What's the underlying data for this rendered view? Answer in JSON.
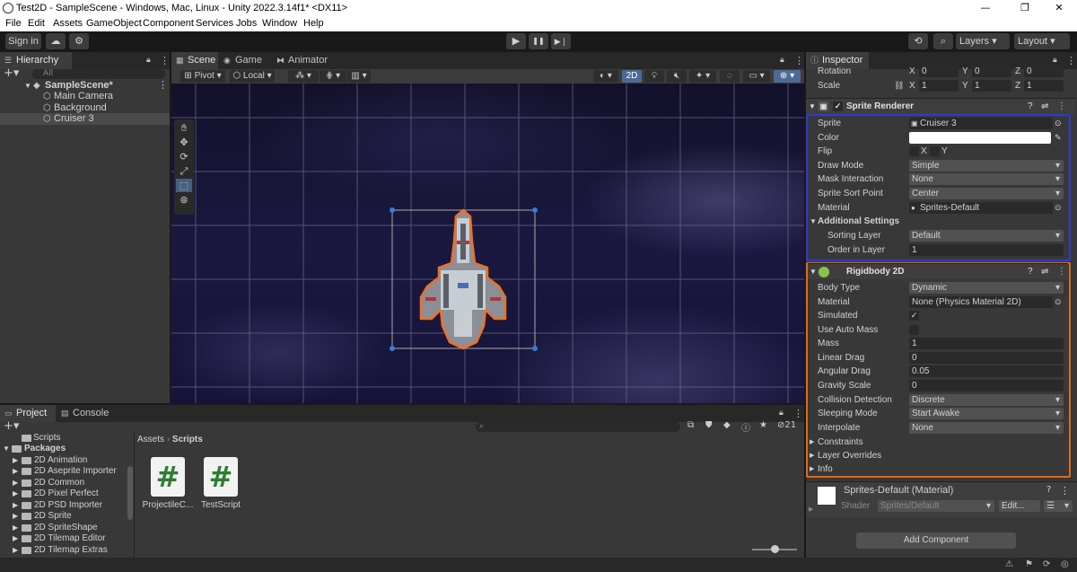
{
  "window": {
    "title": "Test2D - SampleScene - Windows, Mac, Linux - Unity 2022.3.14f1* <DX11>",
    "minimize": "—",
    "maximize": "❐",
    "close": "✕"
  },
  "menu": [
    "File",
    "Edit",
    "Assets",
    "GameObject",
    "Component",
    "Services",
    "Jobs",
    "Window",
    "Help"
  ],
  "toolbar": {
    "sign_in": "Sign in",
    "layers": "Layers",
    "layout": "Layout",
    "play": "▶",
    "pause": "❚❚",
    "step": "▶❘"
  },
  "hierarchy": {
    "tab": "Hierarchy",
    "search_placeholder": "All",
    "scene": "SampleScene*",
    "items": [
      "Main Camera",
      "Background",
      "Cruiser 3"
    ],
    "selected": "Cruiser 3"
  },
  "scene_panel": {
    "tabs": [
      "Scene",
      "Game",
      "Animator"
    ],
    "pivot": "Pivot",
    "local": "Local",
    "mode_2d": "2D"
  },
  "project": {
    "tabs": [
      "Project",
      "Console"
    ],
    "tree": [
      "Scripts",
      "Packages",
      "2D Animation",
      "2D Aseprite Importer",
      "2D Common",
      "2D Pixel Perfect",
      "2D PSD Importer",
      "2D Sprite",
      "2D SpriteShape",
      "2D Tilemap Editor",
      "2D Tilemap Extras"
    ],
    "breadcrumb": [
      "Assets",
      "Scripts"
    ],
    "assets": [
      {
        "name": "ProjectileC...",
        "icon": "#"
      },
      {
        "name": "TestScript",
        "icon": "#"
      }
    ],
    "hidden_count": "21"
  },
  "inspector": {
    "tab": "Inspector",
    "transform": {
      "rotation_label": "Rotation",
      "scale_label": "Scale",
      "rotation": {
        "x": "0",
        "y": "0",
        "z": "0"
      },
      "scale": {
        "x": "1",
        "y": "1",
        "z": "1"
      }
    },
    "sprite_renderer": {
      "title": "Sprite Renderer",
      "sprite_label": "Sprite",
      "sprite": "Cruiser 3",
      "color_label": "Color",
      "flip_label": "Flip",
      "flip_x": "X",
      "flip_y": "Y",
      "draw_mode_label": "Draw Mode",
      "draw_mode": "Simple",
      "mask_label": "Mask Interaction",
      "mask": "None",
      "sort_point_label": "Sprite Sort Point",
      "sort_point": "Center",
      "material_label": "Material",
      "material": "Sprites-Default",
      "additional_label": "Additional Settings",
      "sorting_layer_label": "Sorting Layer",
      "sorting_layer": "Default",
      "order_label": "Order in Layer",
      "order": "1"
    },
    "rigidbody": {
      "title": "Rigidbody 2D",
      "body_type_label": "Body Type",
      "body_type": "Dynamic",
      "material_label": "Material",
      "material": "None (Physics Material 2D)",
      "simulated_label": "Simulated",
      "simulated": "✓",
      "auto_mass_label": "Use Auto Mass",
      "mass_label": "Mass",
      "mass": "1",
      "linear_drag_label": "Linear Drag",
      "linear_drag": "0",
      "angular_drag_label": "Angular Drag",
      "angular_drag": "0.05",
      "gravity_label": "Gravity Scale",
      "gravity": "0",
      "collision_label": "Collision Detection",
      "collision": "Discrete",
      "sleeping_label": "Sleeping Mode",
      "sleeping": "Start Awake",
      "interpolate_label": "Interpolate",
      "interpolate": "None",
      "constraints_label": "Constraints",
      "layer_overrides_label": "Layer Overrides",
      "info_label": "Info"
    },
    "material": {
      "title": "Sprites-Default (Material)",
      "shader_label": "Shader",
      "shader": "Sprites/Default",
      "edit": "Edit..."
    },
    "add_component": "Add Component"
  },
  "colors": {
    "sprite_renderer_highlight": "#2b3bd6",
    "rigidbody_highlight": "#e36a12",
    "selection_outline": "#f07020"
  }
}
